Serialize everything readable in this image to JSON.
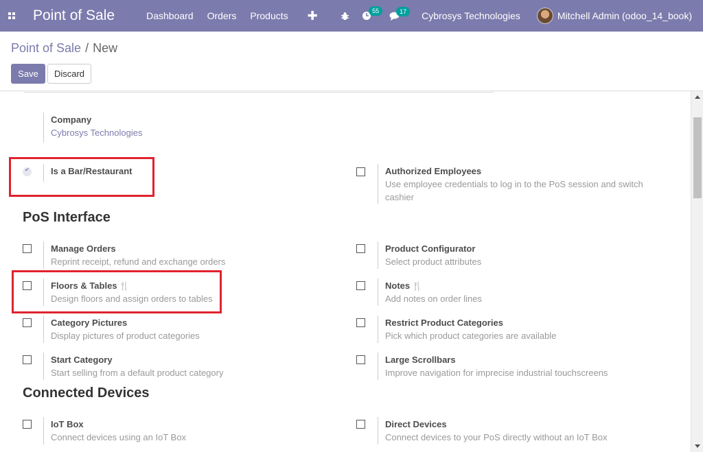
{
  "navbar": {
    "app_name": "Point of Sale",
    "menu": [
      "Dashboard",
      "Orders",
      "Products"
    ],
    "plus_icon": "plus-icon",
    "bug_icon": "bug-icon",
    "activity_count": "55",
    "messages_count": "17",
    "company": "Cybrosys Technologies",
    "user": "Mitchell Admin (odoo_14_book)"
  },
  "breadcrumb": {
    "parent": "Point of Sale",
    "separator": "/",
    "current": "New"
  },
  "buttons": {
    "save": "Save",
    "discard": "Discard"
  },
  "company_field": {
    "label": "Company",
    "value": "Cybrosys Technologies"
  },
  "settings": {
    "bar_restaurant": {
      "label": "Is a Bar/Restaurant",
      "checked": true
    },
    "authorized_employees": {
      "label": "Authorized Employees",
      "desc_line1": "Use employee credentials to log in to the PoS session and switch",
      "desc_line2": "cashier",
      "checked": false
    }
  },
  "pos_interface": {
    "title": "PoS Interface",
    "manage_orders": {
      "label": "Manage Orders",
      "desc": "Reprint receipt, refund and exchange orders"
    },
    "product_configurator": {
      "label": "Product Configurator",
      "desc": "Select product attributes"
    },
    "floors_tables": {
      "label": "Floors & Tables",
      "desc": "Design floors and assign orders to tables"
    },
    "notes": {
      "label": "Notes",
      "desc": "Add notes on order lines"
    },
    "category_pictures": {
      "label": "Category Pictures",
      "desc": "Display pictures of product categories"
    },
    "restrict_categories": {
      "label": "Restrict Product Categories",
      "desc": "Pick which product categories are available"
    },
    "start_category": {
      "label": "Start Category",
      "desc": "Start selling from a default product category"
    },
    "large_scrollbars": {
      "label": "Large Scrollbars",
      "desc": "Improve navigation for imprecise industrial touchscreens"
    }
  },
  "connected_devices": {
    "title": "Connected Devices",
    "iot_box": {
      "label": "IoT Box",
      "desc": "Connect devices using an IoT Box"
    },
    "direct_devices": {
      "label": "Direct Devices",
      "desc": "Connect devices to your PoS directly without an IoT Box"
    }
  },
  "colors": {
    "brand": "#7c7bad",
    "highlight": "#e0222f",
    "badge": "#00a09d"
  }
}
